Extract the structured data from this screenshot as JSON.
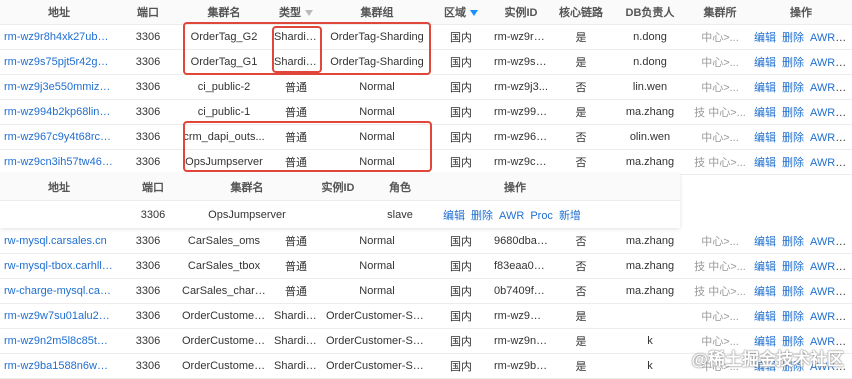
{
  "main_table": {
    "headers": [
      "地址",
      "端口",
      "集群名",
      "类型",
      "集群组",
      "区域",
      "实例ID",
      "核心链路",
      "DB负责人",
      "集群所",
      "操作"
    ],
    "rows": [
      {
        "addr": "rm-wz9r8h4xk27ub9v...",
        "port": "3306",
        "cluster": "OrderTag_G2",
        "type": "Sharding",
        "group": "OrderTag-Sharding",
        "region": "国内",
        "instance": "rm-wz9r8...",
        "core": "是",
        "owner": "n.dong",
        "dept": "中心>..."
      },
      {
        "addr": "rm-wz9s75pjt5r42g7e...",
        "port": "3306",
        "cluster": "OrderTag_G1",
        "type": "Sharding",
        "group": "OrderTag-Sharding",
        "region": "国内",
        "instance": "rm-wz9s7...",
        "core": "是",
        "owner": "n.dong",
        "dept": "中心>..."
      },
      {
        "addr": "rm-wz9j3e550mmizea...",
        "port": "3306",
        "cluster": "ci_public-2",
        "type": "普通",
        "group": "Normal",
        "region": "国内",
        "instance": "rm-wz9j3...",
        "core": "否",
        "owner": "lin.wen",
        "dept": "中心>..."
      },
      {
        "addr": "rm-wz994b2kp68lin7r...",
        "port": "3306",
        "cluster": "ci_public-1",
        "type": "普通",
        "group": "Normal",
        "region": "国内",
        "instance": "rm-wz994...",
        "core": "是",
        "owner": "ma.zhang",
        "dept": "技 中心>..."
      },
      {
        "addr": "rm-wz967c9y4t68rcz...",
        "port": "3306",
        "cluster": "crm_dapi_outs...",
        "type": "普通",
        "group": "Normal",
        "region": "国内",
        "instance": "rm-wz967...",
        "core": "否",
        "owner": "olin.wen",
        "dept": "中心>..."
      },
      {
        "addr": "rm-wz9cn3ih57tw463...",
        "port": "3306",
        "cluster": "OpsJumpserver",
        "type": "普通",
        "group": "Normal",
        "region": "国内",
        "instance": "rm-wz9cn...",
        "core": "否",
        "owner": "ma.zhang",
        "dept": "技 中心>..."
      }
    ],
    "actions": [
      "编辑",
      "删除",
      "AWR",
      "Proc"
    ]
  },
  "nested_table": {
    "headers": [
      "地址",
      "端口",
      "集群名",
      "实例ID",
      "角色",
      "操作"
    ],
    "row": {
      "addr": "",
      "port": "3306",
      "cluster": "OpsJumpserver",
      "instance": "",
      "role": "slave"
    },
    "actions": [
      "编辑",
      "删除",
      "AWR",
      "Proc",
      "新增"
    ]
  },
  "lower_table": {
    "rows": [
      {
        "addr": "rw-mysql.carsales.cn",
        "port": "3306",
        "cluster": "CarSales_oms",
        "type": "普通",
        "group": "Normal",
        "region": "国内",
        "instance": "9680dbaf...",
        "core": "否",
        "owner": "ma.zhang",
        "dept": "中心>..."
      },
      {
        "addr": "rw-mysql-tbox.carhll.cn",
        "port": "3306",
        "cluster": "CarSales_tbox",
        "type": "普通",
        "group": "Normal",
        "region": "国内",
        "instance": "f83eaa0df...",
        "core": "否",
        "owner": "ma.zhang",
        "dept": "技 中心>..."
      },
      {
        "addr": "rw-charge-mysql.cars...",
        "port": "3306",
        "cluster": "CarSales_charge",
        "type": "普通",
        "group": "Normal",
        "region": "国内",
        "instance": "0b7409fb...",
        "core": "否",
        "owner": "ma.zhang",
        "dept": "技 中心>..."
      },
      {
        "addr": "rm-wz9w7su01alu2v6...",
        "port": "3306",
        "cluster": "OrderCustomer...",
        "type": "Sharding",
        "group": "OrderCustomer-Sh...",
        "region": "国内",
        "instance": "rm-wz9w7...",
        "core": "是",
        "owner": "",
        "dept": "中心>..."
      },
      {
        "addr": "rm-wz9n2m5l8c85t51...",
        "port": "3306",
        "cluster": "OrderCustomer...",
        "type": "Sharding",
        "group": "OrderCustomer-Sh...",
        "region": "国内",
        "instance": "rm-wz9n2...",
        "core": "是",
        "owner": "k",
        "dept": "中心>..."
      },
      {
        "addr": "rm-wz9ba1588n6wpy...",
        "port": "3306",
        "cluster": "OrderCustomer...",
        "type": "Sharding",
        "group": "OrderCustomer-Sh...",
        "region": "国内",
        "instance": "rm-wz9ba...",
        "core": "是",
        "owner": "k",
        "dept": "中心>..."
      }
    ]
  },
  "watermark": "@稀土掘金技术社区",
  "colors": {
    "link": "#1f6fd1",
    "highlight": "#e0473a",
    "filter": "#1890ff"
  }
}
